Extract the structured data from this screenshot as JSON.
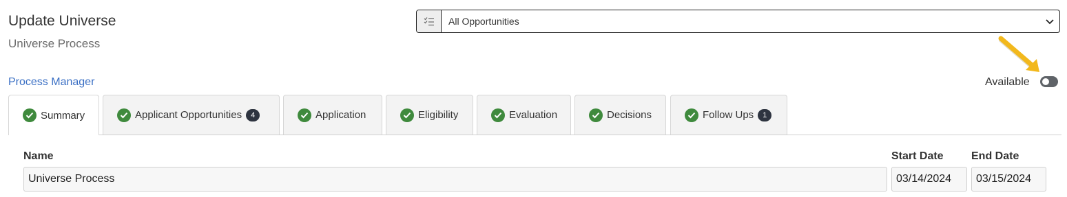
{
  "header": {
    "title": "Update Universe",
    "subtitle": "Universe Process"
  },
  "filter": {
    "icon": "checklist-icon",
    "selected": "All Opportunities"
  },
  "process_manager_link": "Process Manager",
  "availability": {
    "label": "Available",
    "toggle_on": false
  },
  "tabs": [
    {
      "label": "Summary",
      "badge": ""
    },
    {
      "label": "Applicant Opportunities",
      "badge": "4"
    },
    {
      "label": "Application",
      "badge": ""
    },
    {
      "label": "Eligibility",
      "badge": ""
    },
    {
      "label": "Evaluation",
      "badge": ""
    },
    {
      "label": "Decisions",
      "badge": ""
    },
    {
      "label": "Follow Ups",
      "badge": "1"
    }
  ],
  "form": {
    "name_label": "Name",
    "name_value": "Universe Process",
    "start_date_label": "Start Date",
    "start_date_value": "03/14/2024",
    "end_date_label": "End Date",
    "end_date_value": "03/15/2024"
  },
  "colors": {
    "check_green": "#3f8a3d",
    "link_blue": "#3a6fc4",
    "badge_dark": "#2e3440",
    "arrow_yellow": "#f2b81c"
  }
}
